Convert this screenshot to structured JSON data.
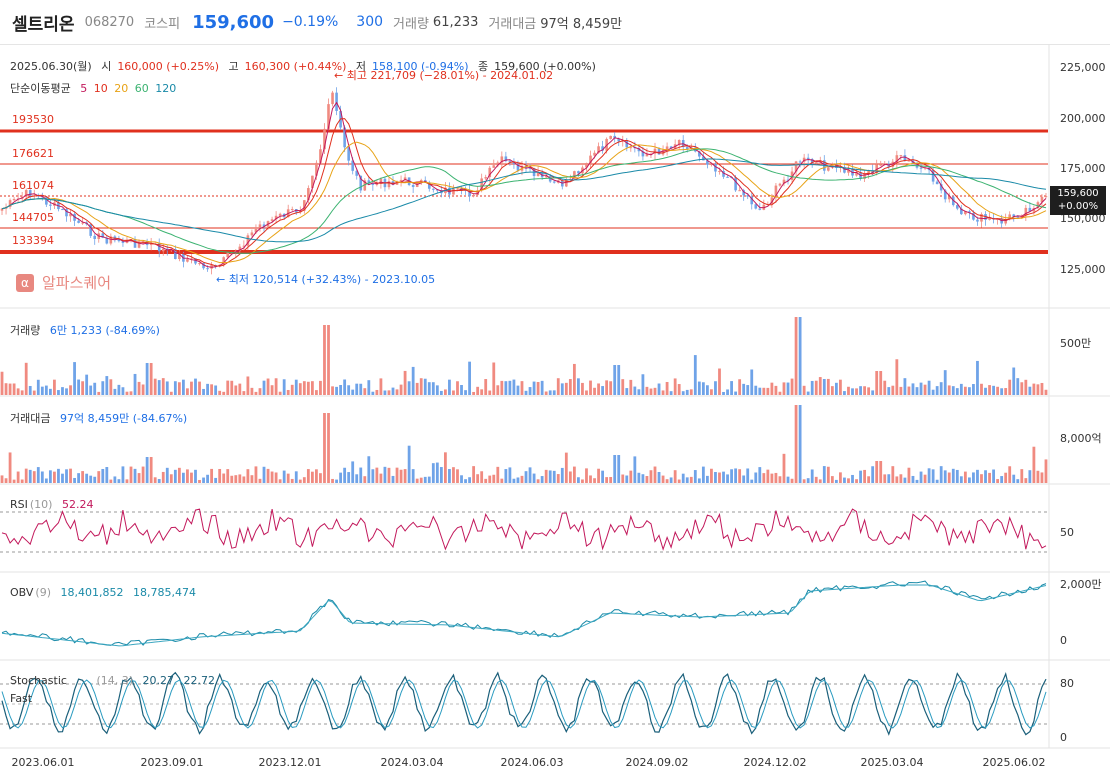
{
  "header": {
    "name": "셀트리온",
    "code": "068270",
    "market": "코스피",
    "price": "159,600",
    "change_pct": "−0.19%",
    "change_abs": "300",
    "volume_label": "거래량",
    "volume_value": "61,233",
    "amount_label": "거래대금",
    "amount_value": "97억 8,459만"
  },
  "price_panel": {
    "date": "2025.06.30(월)",
    "open_label": "시",
    "open_value": "160,000 (+0.25%)",
    "high_label": "고",
    "high_value": "160,300 (+0.44%)",
    "low_label": "저",
    "low_value": "158,100 (-0.94%)",
    "close_label": "종",
    "close_value": "159,600 (+0.00%)",
    "ma_label": "단순이동평균",
    "ma_periods": [
      "5",
      "10",
      "20",
      "60",
      "120"
    ],
    "ma_colors": [
      "#c2185b",
      "#e0301e",
      "#e8a317",
      "#3cb371",
      "#1a8aa8"
    ],
    "high_annotation": "최고 221,709 (−28.01%) - 2024.01.02",
    "low_annotation": "최저 120,514 (+32.43%) - 2023.10.05",
    "levels": [
      "193530",
      "176621",
      "161074",
      "144705",
      "133394"
    ],
    "yticks": [
      "225,000",
      "200,000",
      "175,000",
      "150,000",
      "125,000"
    ],
    "last_price": "159,600",
    "last_change": "+0.00%",
    "watermark": "알파스퀘어"
  },
  "volume_panel": {
    "label": "거래량",
    "value": "6만 1,233 (-84.69%)",
    "ytick": "500만"
  },
  "amount_panel": {
    "label": "거래대금",
    "value": "97억 8,459만 (-84.67%)",
    "ytick": "8,000억"
  },
  "rsi_panel": {
    "label": "RSI",
    "param": "(10)",
    "value": "52.24",
    "ytick": "50"
  },
  "obv_panel": {
    "label": "OBV",
    "param": "(9)",
    "value1": "18,401,852",
    "value2": "18,785,474",
    "ytick_top": "2,000만",
    "ytick_bottom": "0"
  },
  "stoch_panel": {
    "label": "Stochastic",
    "label2": "Fast",
    "param": "(14, 3)",
    "value1": "20.27",
    "value2": "22.72",
    "ytick_top": "80",
    "ytick_bottom": "0"
  },
  "x_axis": [
    "2023.06.01",
    "2023.09.01",
    "2023.12.01",
    "2024.03.04",
    "2024.06.03",
    "2024.09.02",
    "2024.12.02",
    "2025.03.04",
    "2025.06.02"
  ],
  "colors": {
    "up": "#f08a80",
    "down": "#6fa3e8",
    "price_line": "#e0301e",
    "ma5": "#c2185b",
    "ma10": "#e0301e",
    "ma20": "#e8a317",
    "ma60": "#3cb371",
    "ma120": "#1a8aa8",
    "rsi": "#c2185b",
    "obv": "#1a8aa8",
    "stoch": "#1a5f7a"
  }
}
